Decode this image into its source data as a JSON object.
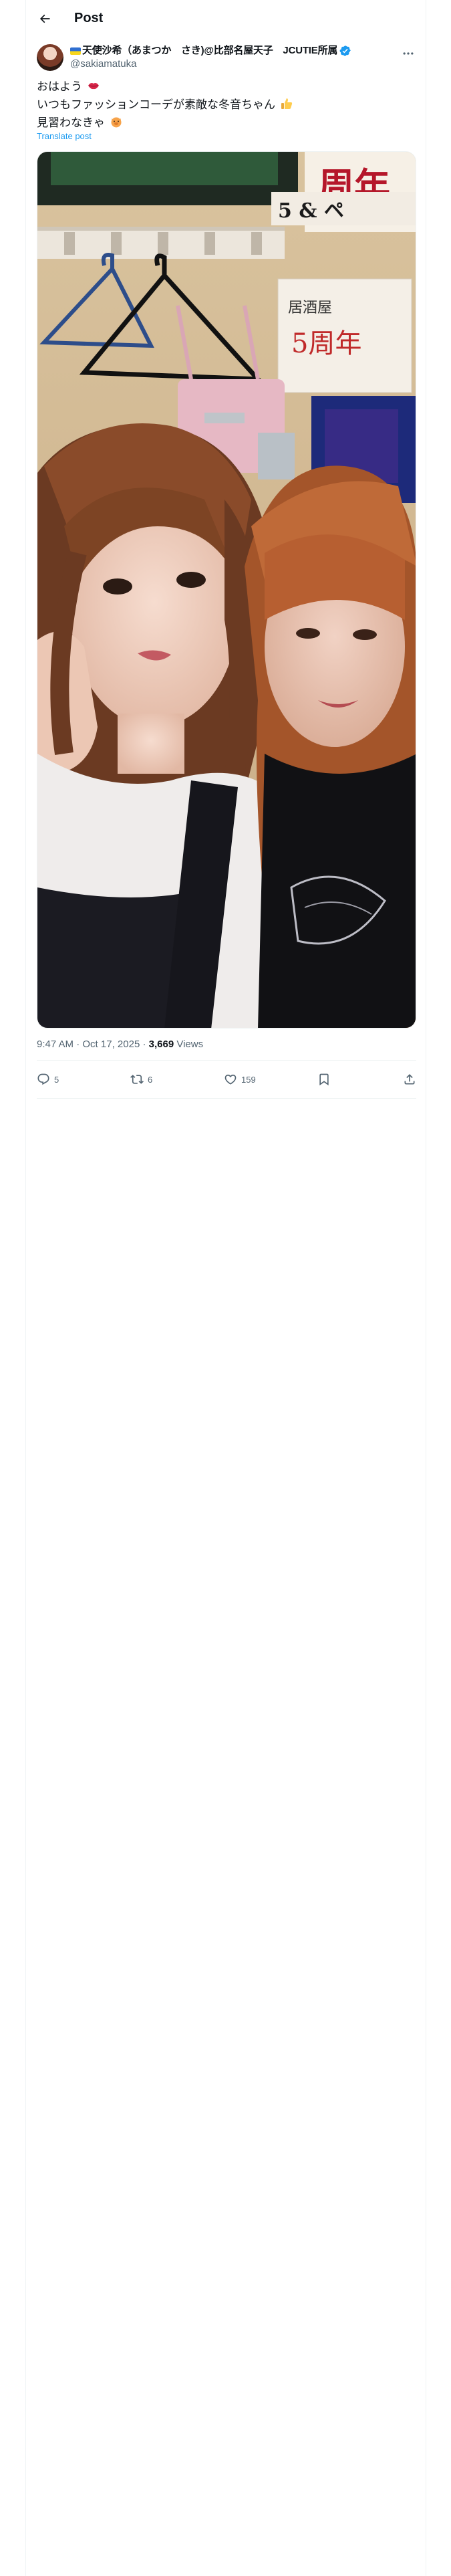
{
  "header": {
    "title": "Post",
    "back_icon": "arrow-left-icon"
  },
  "author": {
    "display_name": "天使沙希（あまつか　さき)@比部名屋天子　JCUTIE所属",
    "handle": "@sakiamatuka",
    "verified": true,
    "flag_icon": "ukraine-flag-icon"
  },
  "tweet": {
    "lines": [
      "おはよう",
      "いつもファッションコーデが素敵な冬音ちゃん",
      "見習わなきゃ"
    ],
    "line_emoji": [
      "lips-emoji",
      "thumbs-up-emoji",
      "pig-emoji"
    ],
    "translate_label": "Translate post"
  },
  "meta": {
    "time": "9:47 AM",
    "separator": "·",
    "date": "Oct 17, 2025",
    "views_count": "3,669",
    "views_label": "Views"
  },
  "actions": {
    "replies": "5",
    "reposts": "6",
    "likes": "159"
  },
  "media": {
    "description_icon": "photo",
    "wall_text": [
      "周年",
      "5 & ペ",
      "居酒屋",
      "5周年"
    ]
  },
  "colors": {
    "accent": "#1d9bf0",
    "text": "#0f1419",
    "muted": "#536471",
    "border": "#eff3f4"
  }
}
